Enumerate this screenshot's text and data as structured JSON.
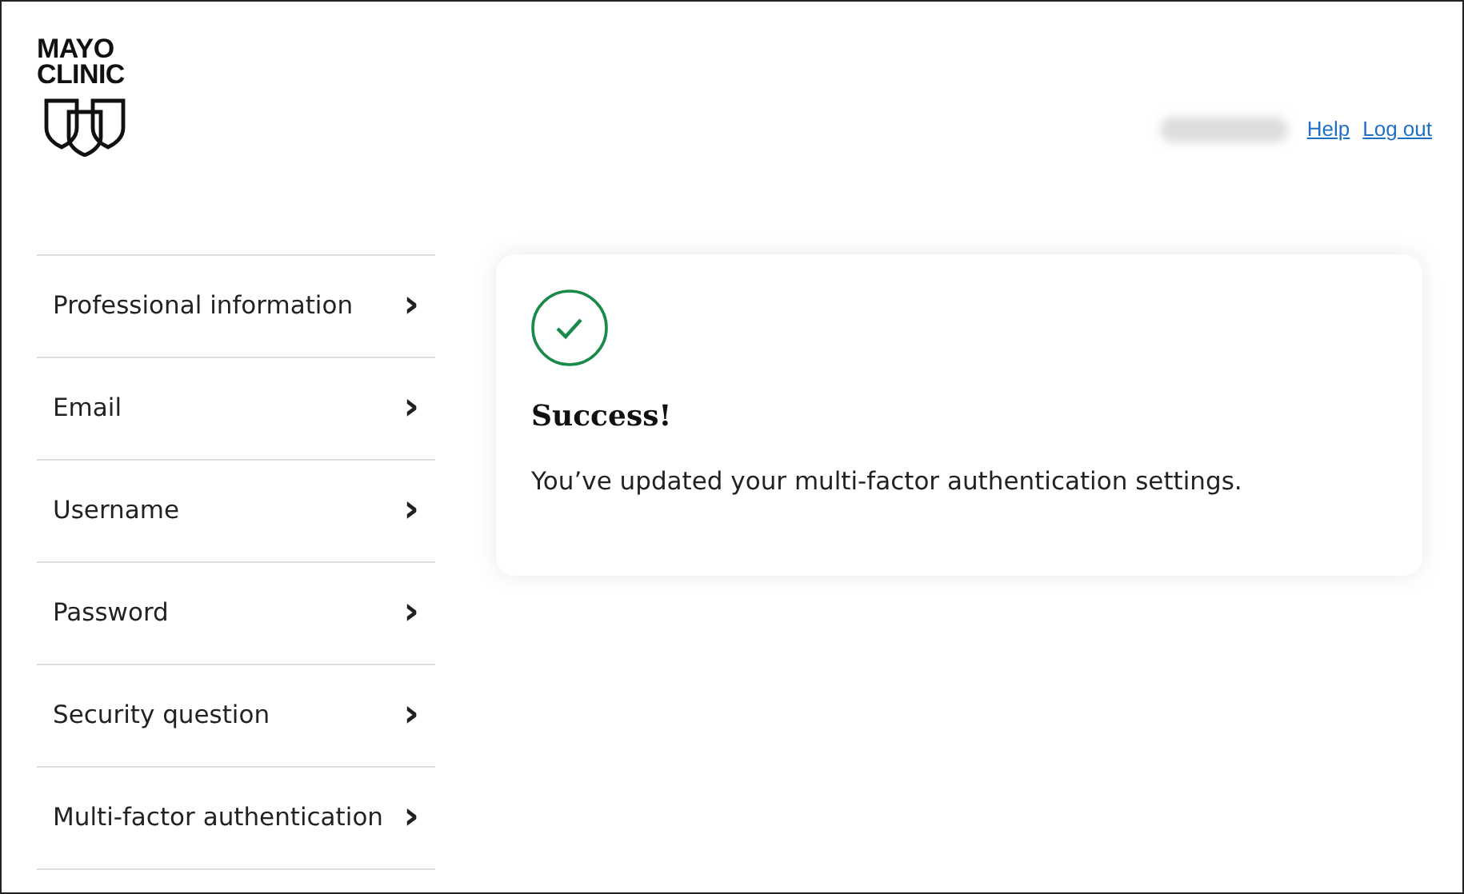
{
  "logo": {
    "line_1": "MAYO",
    "line_2": "CLINIC"
  },
  "header_links": [
    {
      "label": "Help"
    },
    {
      "label": "Log out"
    }
  ],
  "sidebar": {
    "items": [
      {
        "label": "Professional information",
        "chevron": "›"
      },
      {
        "label": "Email",
        "chevron": "›"
      },
      {
        "label": "Username",
        "chevron": "›"
      },
      {
        "label": "Password",
        "chevron": "›"
      },
      {
        "label": "Security question",
        "chevron": "›"
      },
      {
        "label": "Multi-factor authentication",
        "chevron": "›"
      }
    ]
  },
  "message": {
    "kind": "success",
    "title": "Success!",
    "text": "You’ve updated your multi-factor authentication settings."
  }
}
